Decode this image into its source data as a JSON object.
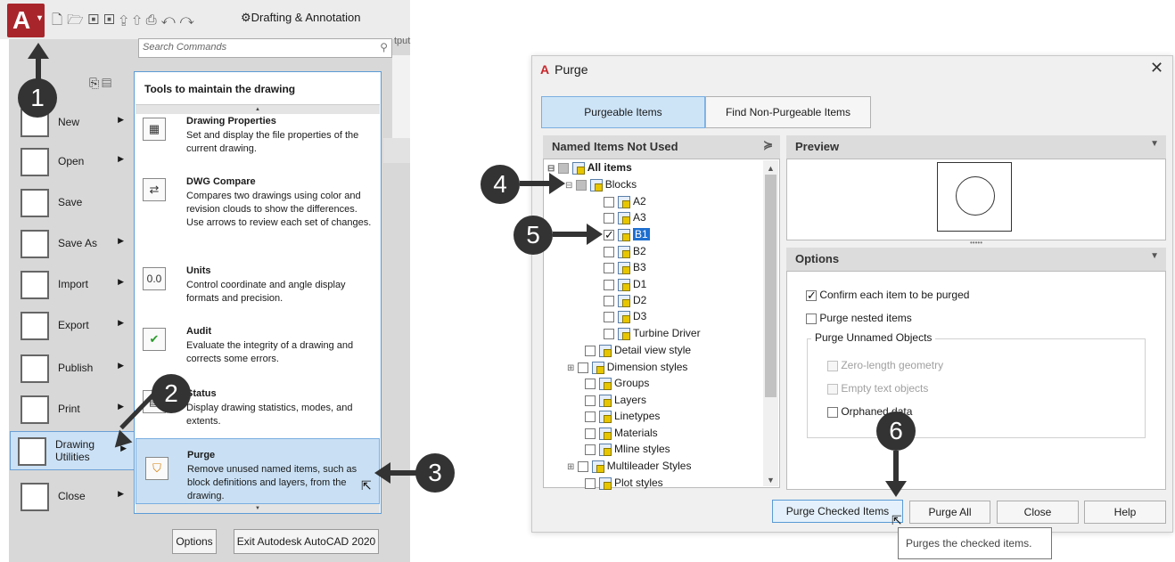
{
  "app": {
    "logo_letter": "A",
    "workspace": "Drafting & Annotation",
    "search_placeholder": "Search Commands",
    "cut_label": "tput"
  },
  "menu": {
    "items": [
      {
        "label": "New"
      },
      {
        "label": "Open"
      },
      {
        "label": "Save"
      },
      {
        "label": "Save As"
      },
      {
        "label": "Import"
      },
      {
        "label": "Export"
      },
      {
        "label": "Publish"
      },
      {
        "label": "Print"
      },
      {
        "label": "Drawing Utilities"
      },
      {
        "label": "Close"
      }
    ],
    "drawing_utilities_line1": "Drawing",
    "drawing_utilities_line2": "Utilities"
  },
  "submenu": {
    "title": "Tools to maintain the drawing",
    "items": [
      {
        "title": "Drawing Properties",
        "desc": "Set and display the file properties of the current drawing."
      },
      {
        "title": "DWG Compare",
        "desc": "Compares two drawings using color and revision clouds to show the differences. Use arrows to review each set of changes."
      },
      {
        "title": "Units",
        "desc": "Control coordinate and angle display formats and precision.",
        "icon_text": "0.0"
      },
      {
        "title": "Audit",
        "desc": "Evaluate the integrity of a drawing and corrects some errors."
      },
      {
        "title": "Status",
        "desc": "Display drawing statistics, modes, and extents."
      },
      {
        "title": "Purge",
        "desc": "Remove unused named items, such as block definitions and layers, from the drawing."
      }
    ],
    "options_label": "Options",
    "exit_label": "Exit Autodesk AutoCAD 2020"
  },
  "callouts": [
    "1",
    "2",
    "3",
    "4",
    "5",
    "6"
  ],
  "dialog": {
    "title": "Purge",
    "tabs": [
      "Purgeable Items",
      "Find Non-Purgeable Items"
    ],
    "named_items_header": "Named Items Not Used",
    "preview_header": "Preview",
    "options_header": "Options",
    "tree": {
      "root": "All items",
      "blocks": "Blocks",
      "block_items": [
        "A2",
        "A3",
        "B1",
        "B2",
        "B3",
        "D1",
        "D2",
        "D3",
        "Turbine Driver"
      ],
      "others": [
        "Detail view style",
        "Dimension styles",
        "Groups",
        "Layers",
        "Linetypes",
        "Materials",
        "Mline styles",
        "Multileader Styles",
        "Plot styles"
      ]
    },
    "options": {
      "confirm": "Confirm each item to be purged",
      "nested": "Purge nested items",
      "unnamed_group": "Purge Unnamed Objects",
      "zero_length": "Zero-length geometry",
      "empty_text": "Empty text objects",
      "orphaned": "Orphaned data"
    },
    "buttons": {
      "purge_checked": "Purge Checked Items",
      "purge_all": "Purge All",
      "close": "Close",
      "help": "Help"
    },
    "tooltip": "Purges the checked items."
  }
}
